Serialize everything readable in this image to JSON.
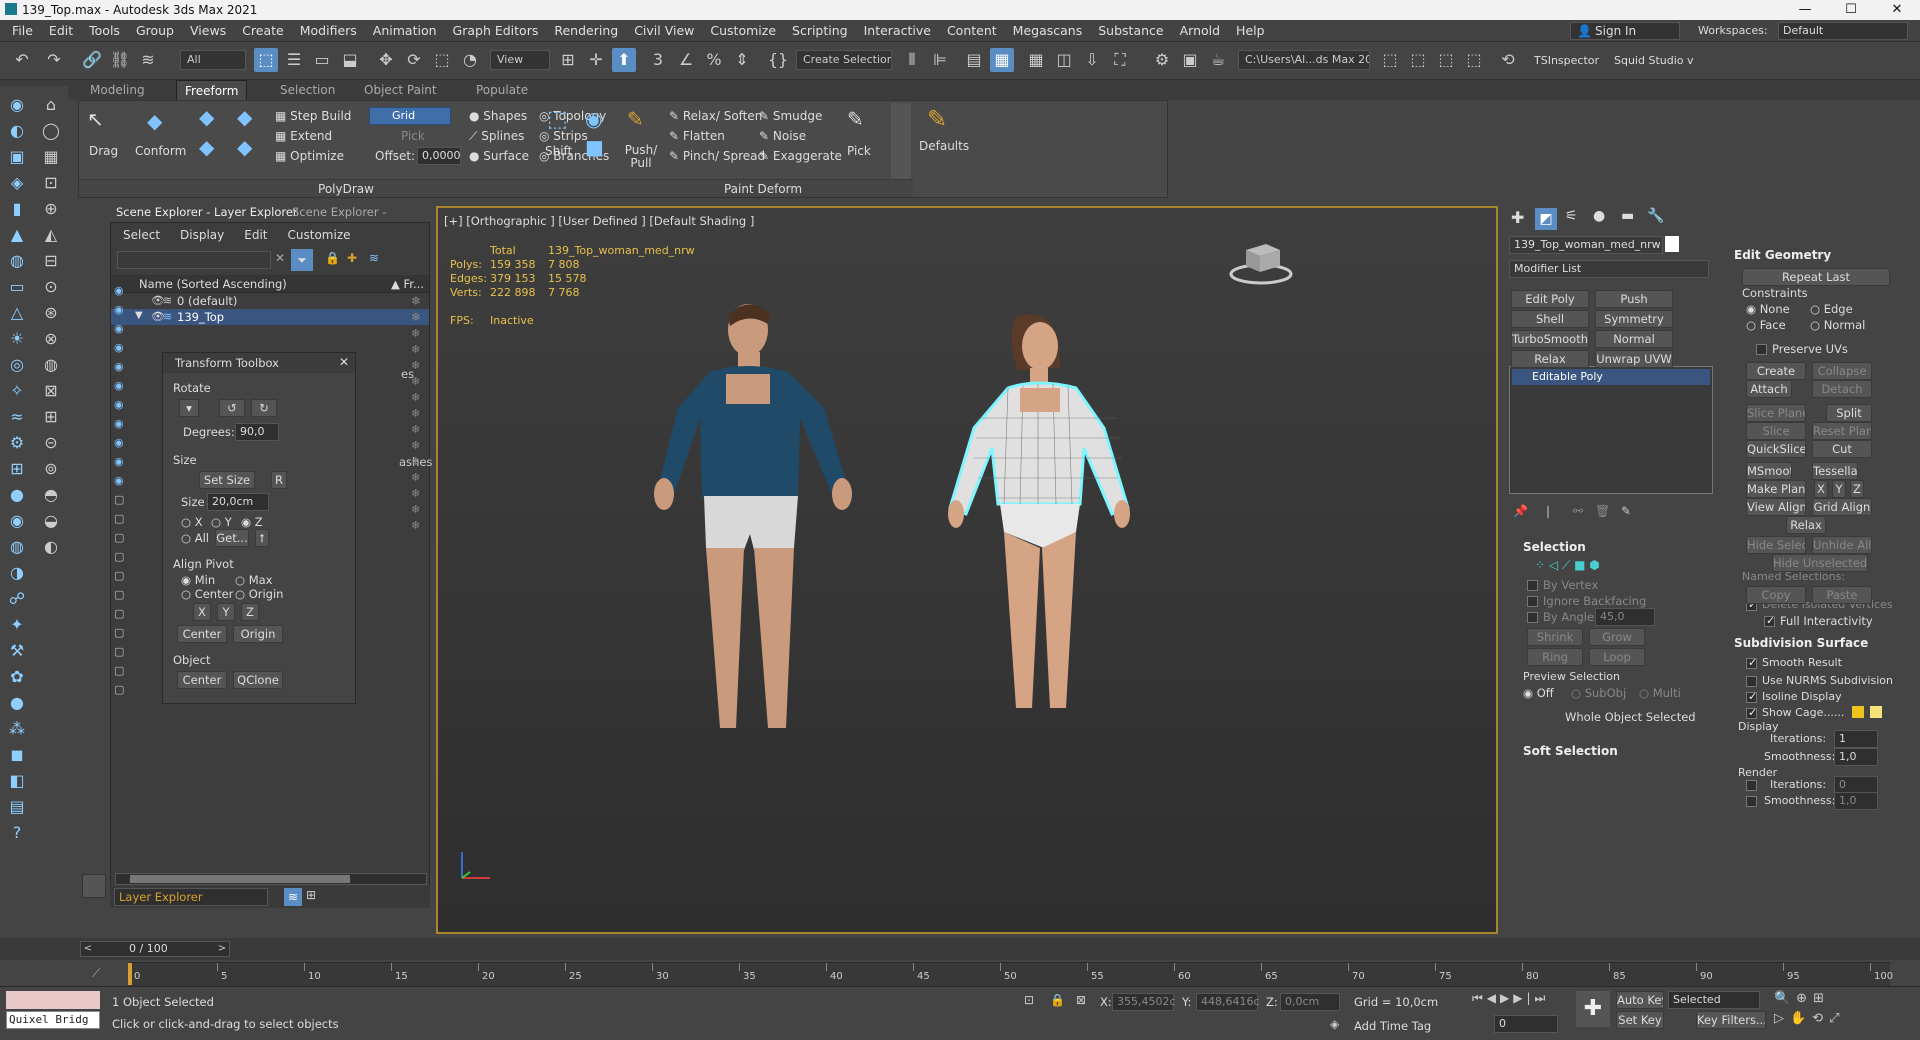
{
  "window": {
    "title": "139_Top.max - Autodesk 3ds Max 2021",
    "min": "—",
    "max": "☐",
    "close": "✕"
  },
  "menu": [
    "File",
    "Edit",
    "Tools",
    "Group",
    "Views",
    "Create",
    "Modifiers",
    "Animation",
    "Graph Editors",
    "Rendering",
    "Civil View",
    "Customize",
    "Scripting",
    "Interactive",
    "Content",
    "Megascans",
    "Substance",
    "Arnold",
    "Help"
  ],
  "signin": "Sign In",
  "workspace_label": "Workspaces:",
  "workspace_value": "Default",
  "toolbar": {
    "filter": "All",
    "view": "View",
    "selset": "Create Selection Se",
    "path": "C:\\Users\\Al...ds Max 202:",
    "ts": "TSInspector",
    "squid": "Squid Studio v"
  },
  "ribbon_tabs": [
    "Modeling",
    "Freeform",
    "Selection",
    "Object Paint",
    "Populate"
  ],
  "ribbon": {
    "drag": "Drag",
    "conform": "Conform",
    "step_build": "Step Build",
    "extend": "Extend",
    "optimize": "Optimize",
    "grid": "Grid",
    "pick": "Pick",
    "offset_label": "Offset:",
    "offset_value": "0,0000",
    "shapes": "Shapes",
    "splines": "Splines",
    "surface": "Surface",
    "topology": "Topology",
    "strips": "Strips",
    "branches": "Branches",
    "polydraw": "PolyDraw",
    "shift": "Shift",
    "pushpull": "Push/ Pull",
    "relax_soften": "Relax/ Soften",
    "flatten": "Flatten",
    "pinch_spread": "Pinch/ Spread",
    "smudge": "Smudge",
    "noise": "Noise",
    "exaggerate": "Exaggerate",
    "paint_deform": "Paint Deform",
    "pick2": "Pick",
    "defaults": "Defaults"
  },
  "explorer": {
    "tab1": "Scene Explorer - Layer Explorer",
    "tab2": "Scene Explorer - Default",
    "menu": [
      "Select",
      "Display",
      "Edit",
      "Customize"
    ],
    "col_name": "Name (Sorted Ascending)",
    "col_fr": "▲ Fr...",
    "rows": [
      "0 (default)",
      "139_Top"
    ],
    "bottom": "Layer Explorer",
    "partial1": "es",
    "partial2": "ashes"
  },
  "toolbox": {
    "title": "Transform Toolbox",
    "rotate": "Rotate",
    "degrees_label": "Degrees:",
    "degrees_value": "90,0",
    "size": "Size",
    "set_size": "Set Size",
    "r": "R",
    "size_label": "Size",
    "size_value": "20,0cm",
    "x": "X",
    "y": "Y",
    "z": "Z",
    "all": "All",
    "get": "Get...",
    "align_pivot": "Align Pivot",
    "min": "Min",
    "max": "Max",
    "center": "Center",
    "origin": "Origin",
    "center_btn": "Center",
    "origin_btn": "Origin",
    "object": "Object",
    "obj_center": "Center",
    "qclone": "QClone"
  },
  "viewport": {
    "label": "[+] [Orthographic ] [User Defined ] [Default Shading ]",
    "stats": {
      "total": "Total",
      "name": "139_Top_woman_med_nrw",
      "polys_label": "Polys:",
      "polys_total": "159 358",
      "polys_sel": "7 808",
      "edges_label": "Edges:",
      "edges_total": "379 153",
      "edges_sel": "15 578",
      "verts_label": "Verts:",
      "verts_total": "222 898",
      "verts_sel": "7 768",
      "fps_label": "FPS:",
      "fps_value": "Inactive"
    }
  },
  "modify": {
    "object_name": "139_Top_woman_med_nrw",
    "modifier_list": "Modifier List",
    "buttons": [
      "Edit Poly",
      "Push",
      "Shell",
      "Symmetry",
      "TurboSmooth",
      "Normal",
      "Relax",
      "Unwrap UVW"
    ],
    "stack_item": "Editable Poly",
    "selection": "Selection",
    "by_vertex": "By Vertex",
    "ignore_backfacing": "Ignore Backfacing",
    "by_angle": "By Angle:",
    "by_angle_val": "45,0",
    "shrink": "Shrink",
    "grow": "Grow",
    "ring": "Ring",
    "loop": "Loop",
    "preview_selection": "Preview Selection",
    "off": "Off",
    "subobj": "SubObj",
    "multi": "Multi",
    "whole_object": "Whole Object Selected",
    "soft_selection": "Soft Selection"
  },
  "edit_geom": {
    "title": "Edit Geometry",
    "repeat_last": "Repeat Last",
    "constraints": "Constraints",
    "none": "None",
    "edge": "Edge",
    "face": "Face",
    "normal": "Normal",
    "preserve_uvs": "Preserve UVs",
    "create": "Create",
    "collapse": "Collapse",
    "attach": "Attach",
    "detach": "Detach",
    "slice_plane": "Slice Plane",
    "split": "Split",
    "slice": "Slice",
    "reset_plane": "Reset Plane",
    "quickslice": "QuickSlice",
    "cut": "Cut",
    "msmooth": "MSmooth",
    "tessellate": "Tessellate",
    "make_planar": "Make Planar",
    "x": "X",
    "y": "Y",
    "z": "Z",
    "view_align": "View Align",
    "grid_align": "Grid Align",
    "relax": "Relax",
    "hide_selected": "Hide Selected",
    "unhide_all": "Unhide All",
    "hide_unselected": "Hide Unselected",
    "named_selections": "Named Selections:",
    "copy": "Copy",
    "paste": "Paste",
    "delete_isolated": "Delete Isolated Vertices",
    "full_interactivity": "Full Interactivity"
  },
  "subdiv": {
    "title": "Subdivision Surface",
    "smooth_result": "Smooth Result",
    "use_nurms": "Use NURMS Subdivision",
    "isoline": "Isoline Display",
    "show_cage": "Show Cage......",
    "display": "Display",
    "iterations": "Iterations:",
    "iter_val": "1",
    "smoothness": "Smoothness:",
    "smooth_val": "1,0",
    "render": "Render",
    "r_iterations": "Iterations:",
    "r_iter_val": "0",
    "r_smoothness": "Smoothness:",
    "r_smooth_val": "1,0"
  },
  "timeline": {
    "frame": "0 / 100",
    "ticks": [
      "0",
      "5",
      "10",
      "15",
      "20",
      "25",
      "30",
      "35",
      "40",
      "45",
      "50",
      "55",
      "60",
      "65",
      "70",
      "75",
      "80",
      "85",
      "90",
      "95",
      "100"
    ]
  },
  "status": {
    "quixel": "Quixel Bridg",
    "selected": "1 Object Selected",
    "hint": "Click or click-and-drag to select objects",
    "x_label": "X:",
    "x_val": "355,4502c",
    "y_label": "Y:",
    "y_val": "448,6416c",
    "z_label": "Z:",
    "z_val": "0,0cm",
    "grid": "Grid = 10,0cm",
    "add_time_tag": "Add Time Tag",
    "auto_key": "Auto Key",
    "set_key": "Set Key",
    "selected_dd": "Selected",
    "key_filters": "Key Filters...",
    "frame_val": "0"
  },
  "colors": {
    "accent": "#5a8dc4",
    "viewport_border": "#a8862e",
    "stats": "#e8c04a",
    "mesh": "#7ff6ff"
  }
}
